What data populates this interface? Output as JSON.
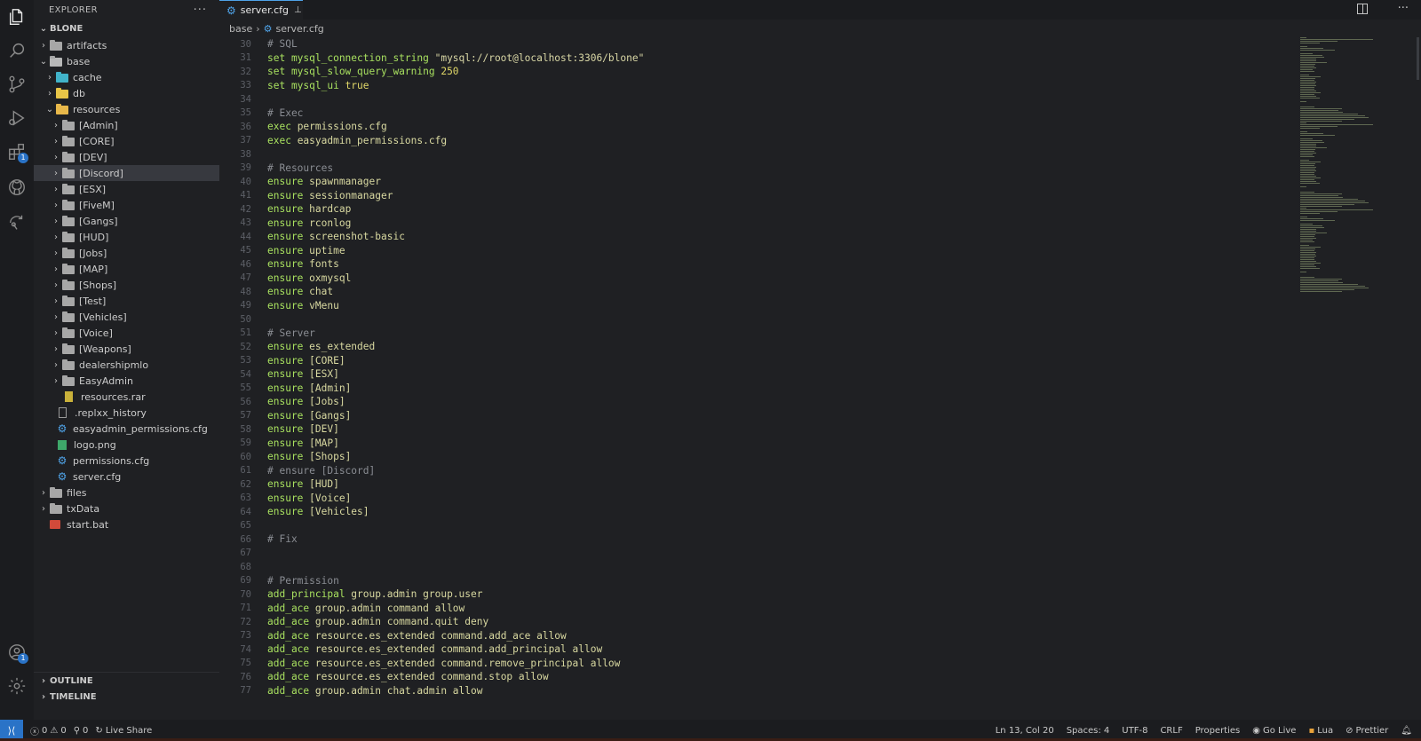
{
  "sidebar": {
    "title": "EXPLORER",
    "more": "···",
    "root": "BLONE",
    "tree": [
      {
        "label": "artifacts",
        "depth": 0,
        "type": "folder",
        "chevron": "right"
      },
      {
        "label": "base",
        "depth": 0,
        "type": "folder-open",
        "chevron": "down"
      },
      {
        "label": "cache",
        "depth": 1,
        "type": "folder-cache",
        "chevron": "right"
      },
      {
        "label": "db",
        "depth": 1,
        "type": "folder-db",
        "chevron": "right"
      },
      {
        "label": "resources",
        "depth": 1,
        "type": "folder-res",
        "chevron": "down"
      },
      {
        "label": "[Admin]",
        "depth": 2,
        "type": "folder",
        "chevron": "right"
      },
      {
        "label": "[CORE]",
        "depth": 2,
        "type": "folder",
        "chevron": "right"
      },
      {
        "label": "[DEV]",
        "depth": 2,
        "type": "folder",
        "chevron": "right"
      },
      {
        "label": "[Discord]",
        "depth": 2,
        "type": "folder",
        "chevron": "right",
        "selected": true
      },
      {
        "label": "[ESX]",
        "depth": 2,
        "type": "folder",
        "chevron": "right"
      },
      {
        "label": "[FiveM]",
        "depth": 2,
        "type": "folder",
        "chevron": "right"
      },
      {
        "label": "[Gangs]",
        "depth": 2,
        "type": "folder",
        "chevron": "right"
      },
      {
        "label": "[HUD]",
        "depth": 2,
        "type": "folder",
        "chevron": "right"
      },
      {
        "label": "[Jobs]",
        "depth": 2,
        "type": "folder",
        "chevron": "right"
      },
      {
        "label": "[MAP]",
        "depth": 2,
        "type": "folder",
        "chevron": "right"
      },
      {
        "label": "[Shops]",
        "depth": 2,
        "type": "folder",
        "chevron": "right"
      },
      {
        "label": "[Test]",
        "depth": 2,
        "type": "folder",
        "chevron": "right"
      },
      {
        "label": "[Vehicles]",
        "depth": 2,
        "type": "folder",
        "chevron": "right"
      },
      {
        "label": "[Voice]",
        "depth": 2,
        "type": "folder",
        "chevron": "right"
      },
      {
        "label": "[Weapons]",
        "depth": 2,
        "type": "folder",
        "chevron": "right"
      },
      {
        "label": "dealershipmlo",
        "depth": 2,
        "type": "folder",
        "chevron": "right"
      },
      {
        "label": "EasyAdmin",
        "depth": 2,
        "type": "folder",
        "chevron": "right"
      },
      {
        "label": "resources.rar",
        "depth": 2,
        "type": "rar",
        "chevron": ""
      },
      {
        "label": ".replxx_history",
        "depth": 1,
        "type": "doc",
        "chevron": ""
      },
      {
        "label": "easyadmin_permissions.cfg",
        "depth": 1,
        "type": "gear",
        "chevron": ""
      },
      {
        "label": "logo.png",
        "depth": 1,
        "type": "img",
        "chevron": ""
      },
      {
        "label": "permissions.cfg",
        "depth": 1,
        "type": "gear",
        "chevron": ""
      },
      {
        "label": "server.cfg",
        "depth": 1,
        "type": "gear",
        "chevron": ""
      },
      {
        "label": "files",
        "depth": 0,
        "type": "folder",
        "chevron": "right"
      },
      {
        "label": "txData",
        "depth": 0,
        "type": "folder",
        "chevron": "right"
      },
      {
        "label": "start.bat",
        "depth": 0,
        "type": "bat",
        "chevron": ""
      }
    ],
    "outline": "OUTLINE",
    "timeline": "TIMELINE"
  },
  "activity": {
    "extensions_badge": "1",
    "accounts_badge": "1"
  },
  "editor": {
    "tab_label": "server.cfg",
    "breadcrumb": [
      "base",
      "server.cfg"
    ],
    "lines": [
      {
        "n": "30",
        "segs": [
          [
            "cm",
            "# SQL"
          ]
        ]
      },
      {
        "n": "31",
        "segs": [
          [
            "kw",
            "set mysql_connection_string "
          ],
          [
            "st",
            "\"mysql://root@localhost:3306/blone\""
          ]
        ]
      },
      {
        "n": "32",
        "segs": [
          [
            "kw",
            "set mysql_slow_query_warning "
          ],
          [
            "nm",
            "250"
          ]
        ]
      },
      {
        "n": "33",
        "segs": [
          [
            "kw",
            "set mysql_ui "
          ],
          [
            "nm",
            "true"
          ]
        ]
      },
      {
        "n": "34",
        "segs": []
      },
      {
        "n": "35",
        "segs": [
          [
            "cm",
            "# Exec"
          ]
        ]
      },
      {
        "n": "36",
        "segs": [
          [
            "kw",
            "exec "
          ],
          [
            "pl",
            "permissions.cfg"
          ]
        ]
      },
      {
        "n": "37",
        "segs": [
          [
            "kw",
            "exec "
          ],
          [
            "pl",
            "easyadmin_permissions.cfg"
          ]
        ]
      },
      {
        "n": "38",
        "segs": []
      },
      {
        "n": "39",
        "segs": [
          [
            "cm",
            "# Resources"
          ]
        ]
      },
      {
        "n": "40",
        "segs": [
          [
            "kw",
            "ensure "
          ],
          [
            "pl",
            "spawnmanager"
          ]
        ]
      },
      {
        "n": "41",
        "segs": [
          [
            "kw",
            "ensure "
          ],
          [
            "pl",
            "sessionmanager"
          ]
        ]
      },
      {
        "n": "42",
        "segs": [
          [
            "kw",
            "ensure "
          ],
          [
            "pl",
            "hardcap"
          ]
        ]
      },
      {
        "n": "43",
        "segs": [
          [
            "kw",
            "ensure "
          ],
          [
            "pl",
            "rconlog"
          ]
        ]
      },
      {
        "n": "44",
        "segs": [
          [
            "kw",
            "ensure "
          ],
          [
            "pl",
            "screenshot-basic"
          ]
        ]
      },
      {
        "n": "45",
        "segs": [
          [
            "kw",
            "ensure "
          ],
          [
            "pl",
            "uptime"
          ]
        ]
      },
      {
        "n": "46",
        "segs": [
          [
            "kw",
            "ensure "
          ],
          [
            "pl",
            "fonts"
          ]
        ]
      },
      {
        "n": "47",
        "segs": [
          [
            "kw",
            "ensure "
          ],
          [
            "pl",
            "oxmysql"
          ]
        ]
      },
      {
        "n": "48",
        "segs": [
          [
            "kw",
            "ensure "
          ],
          [
            "pl",
            "chat"
          ]
        ]
      },
      {
        "n": "49",
        "segs": [
          [
            "kw",
            "ensure "
          ],
          [
            "pl",
            "vMenu"
          ]
        ]
      },
      {
        "n": "50",
        "segs": []
      },
      {
        "n": "51",
        "segs": [
          [
            "cm",
            "# Server"
          ]
        ]
      },
      {
        "n": "52",
        "segs": [
          [
            "kw",
            "ensure "
          ],
          [
            "pl",
            "es_extended"
          ]
        ]
      },
      {
        "n": "53",
        "segs": [
          [
            "kw",
            "ensure "
          ],
          [
            "pl",
            "[CORE]"
          ]
        ]
      },
      {
        "n": "54",
        "segs": [
          [
            "kw",
            "ensure "
          ],
          [
            "pl",
            "[ESX]"
          ]
        ]
      },
      {
        "n": "55",
        "segs": [
          [
            "kw",
            "ensure "
          ],
          [
            "pl",
            "[Admin]"
          ]
        ]
      },
      {
        "n": "56",
        "segs": [
          [
            "kw",
            "ensure "
          ],
          [
            "pl",
            "[Jobs]"
          ]
        ]
      },
      {
        "n": "57",
        "segs": [
          [
            "kw",
            "ensure "
          ],
          [
            "pl",
            "[Gangs]"
          ]
        ]
      },
      {
        "n": "58",
        "segs": [
          [
            "kw",
            "ensure "
          ],
          [
            "pl",
            "[DEV]"
          ]
        ]
      },
      {
        "n": "59",
        "segs": [
          [
            "kw",
            "ensure "
          ],
          [
            "pl",
            "[MAP]"
          ]
        ]
      },
      {
        "n": "60",
        "segs": [
          [
            "kw",
            "ensure "
          ],
          [
            "pl",
            "[Shops]"
          ]
        ]
      },
      {
        "n": "61",
        "segs": [
          [
            "cm",
            "# ensure [Discord]"
          ]
        ]
      },
      {
        "n": "62",
        "segs": [
          [
            "kw",
            "ensure "
          ],
          [
            "pl",
            "[HUD]"
          ]
        ]
      },
      {
        "n": "63",
        "segs": [
          [
            "kw",
            "ensure "
          ],
          [
            "pl",
            "[Voice]"
          ]
        ]
      },
      {
        "n": "64",
        "segs": [
          [
            "kw",
            "ensure "
          ],
          [
            "pl",
            "[Vehicles]"
          ]
        ]
      },
      {
        "n": "65",
        "segs": []
      },
      {
        "n": "66",
        "segs": [
          [
            "cm",
            "# Fix"
          ]
        ]
      },
      {
        "n": "67",
        "segs": []
      },
      {
        "n": "68",
        "segs": []
      },
      {
        "n": "69",
        "segs": [
          [
            "cm",
            "# Permission"
          ]
        ]
      },
      {
        "n": "70",
        "segs": [
          [
            "kw",
            "add_principal "
          ],
          [
            "pl",
            "group.admin group.user"
          ]
        ]
      },
      {
        "n": "71",
        "segs": [
          [
            "kw",
            "add_ace "
          ],
          [
            "pl",
            "group.admin command allow"
          ]
        ]
      },
      {
        "n": "72",
        "segs": [
          [
            "kw",
            "add_ace "
          ],
          [
            "pl",
            "group.admin command.quit deny"
          ]
        ]
      },
      {
        "n": "73",
        "segs": [
          [
            "kw",
            "add_ace "
          ],
          [
            "pl",
            "resource.es_extended command.add_ace allow"
          ]
        ]
      },
      {
        "n": "74",
        "segs": [
          [
            "kw",
            "add_ace "
          ],
          [
            "pl",
            "resource.es_extended command.add_principal allow"
          ]
        ]
      },
      {
        "n": "75",
        "segs": [
          [
            "kw",
            "add_ace "
          ],
          [
            "pl",
            "resource.es_extended command.remove_principal allow"
          ]
        ]
      },
      {
        "n": "76",
        "segs": [
          [
            "kw",
            "add_ace "
          ],
          [
            "pl",
            "resource.es_extended command.stop allow"
          ]
        ]
      },
      {
        "n": "77",
        "segs": [
          [
            "kw",
            "add_ace "
          ],
          [
            "pl",
            "group.admin chat.admin allow"
          ]
        ]
      }
    ]
  },
  "status": {
    "errors": "0",
    "warnings": "0",
    "ports": "0",
    "live_share": "Live Share",
    "position": "Ln 13, Col 20",
    "spaces": "Spaces: 4",
    "encoding": "UTF-8",
    "eol": "CRLF",
    "language_mode": "Properties",
    "go_live": "Go Live",
    "lua": "Lua",
    "prettier": "Prettier"
  },
  "colors": {
    "keyword": "#a8e05f",
    "comment": "#8a8d93",
    "string": "#d9d7a5",
    "accent": "#2a73c7"
  }
}
